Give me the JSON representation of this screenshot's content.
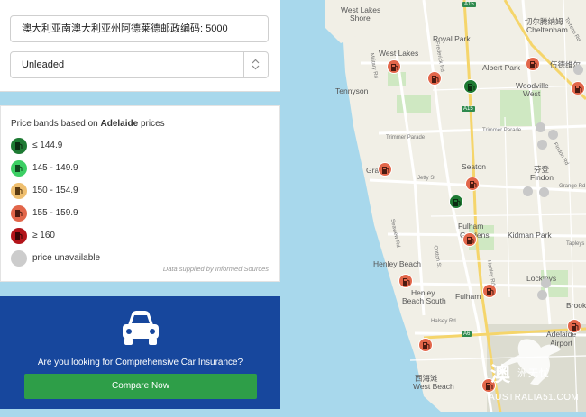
{
  "search": {
    "location_value": "澳大利亚南澳大利亚州阿德莱德邮政编码: 5000",
    "fuel_selected": "Unleaded"
  },
  "legend": {
    "title_prefix": "Price bands based on",
    "city": "Adelaide",
    "title_suffix": "prices",
    "bands": [
      {
        "label": "≤ 144.9",
        "color": "#1e7a33"
      },
      {
        "label": "145 - 149.9",
        "color": "#3ccf64"
      },
      {
        "label": "150 - 154.9",
        "color": "#efbf6f"
      },
      {
        "label": "155 - 159.9",
        "color": "#e2664a"
      },
      {
        "label": "≥ 160",
        "color": "#b3141a"
      },
      {
        "label": "price unavailable",
        "color": "#cccccc"
      }
    ],
    "credit": "Data supplied by Informed Sources"
  },
  "insurance": {
    "question": "Are you looking for Comprehensive Car Insurance?",
    "button": "Compare Now"
  },
  "map": {
    "labels": [
      {
        "text": "West Lakes",
        "cls": ""
      },
      {
        "text": "Shore",
        "cls": ""
      },
      {
        "text": "Royal Park",
        "cls": ""
      },
      {
        "text": "West Lakes",
        "cls": ""
      },
      {
        "text": "Albert Park",
        "cls": ""
      },
      {
        "text": "Woodville",
        "cls": ""
      },
      {
        "text": "West",
        "cls": ""
      },
      {
        "text": "Tennyson",
        "cls": ""
      },
      {
        "text": "切尔腾纳姆",
        "cls": ""
      },
      {
        "text": "Cheltenham",
        "cls": ""
      },
      {
        "text": "伍德维尔",
        "cls": ""
      },
      {
        "text": "Grange",
        "cls": ""
      },
      {
        "text": "Seaton",
        "cls": ""
      },
      {
        "text": "芬登",
        "cls": ""
      },
      {
        "text": "Findon",
        "cls": ""
      },
      {
        "text": "Fulham",
        "cls": ""
      },
      {
        "text": "Gardens",
        "cls": ""
      },
      {
        "text": "Kidman Park",
        "cls": ""
      },
      {
        "text": "Henley Beach",
        "cls": ""
      },
      {
        "text": "Lockleys",
        "cls": ""
      },
      {
        "text": "Henley",
        "cls": ""
      },
      {
        "text": "Beach South",
        "cls": ""
      },
      {
        "text": "Fulham",
        "cls": ""
      },
      {
        "text": "Brooklyn",
        "cls": ""
      },
      {
        "text": "Adelaide",
        "cls": ""
      },
      {
        "text": "Airport",
        "cls": ""
      },
      {
        "text": "西海滩",
        "cls": ""
      },
      {
        "text": "West Beach",
        "cls": ""
      },
      {
        "text": "Trimmer Parade",
        "cls": "sm"
      },
      {
        "text": "Trimmer Parade",
        "cls": "sm"
      },
      {
        "text": "Military Rd",
        "cls": "sm"
      },
      {
        "text": "Frederick Rd",
        "cls": "sm"
      },
      {
        "text": "Jetty St",
        "cls": "sm"
      },
      {
        "text": "Seaview Rd",
        "cls": "sm"
      },
      {
        "text": "Cotton St",
        "cls": "sm"
      },
      {
        "text": "Hartley Rd",
        "cls": "sm"
      },
      {
        "text": "Halsey Rd",
        "cls": "sm"
      },
      {
        "text": "Torrens Rd",
        "cls": "sm"
      },
      {
        "text": "Findon Rd",
        "cls": "sm"
      },
      {
        "text": "Tapleys",
        "cls": "sm"
      },
      {
        "text": "Grange Rd",
        "cls": "sm"
      }
    ],
    "shields": [
      "A15",
      "A15",
      "A6"
    ]
  },
  "watermark": {
    "big": "澳",
    "small": "洲无忧",
    "url": "AUSTRALIA51.COM"
  }
}
